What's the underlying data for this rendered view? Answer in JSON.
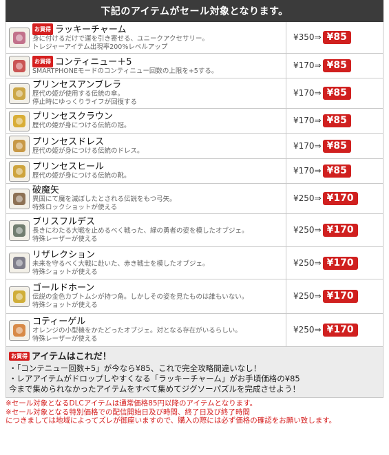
{
  "header": "下記のアイテムがセール対象となります。",
  "deal_badge": "お買得",
  "arrow": "⇒",
  "items": [
    {
      "name": "ラッキーチャーム",
      "desc1": "身に付けるだけで運を引き寄せる、ユニークアクセサリー。",
      "desc2": "トレジャーアイテム出現率200%レベルアップ",
      "old": "¥350",
      "new": "¥85",
      "deal": true,
      "icon": "lucky-charm-icon",
      "color": "#b85a7a"
    },
    {
      "name": "コンティニュー＋5",
      "desc1": "SMARTPHONEモードのコンティニュー回数の上限を+5する。",
      "desc2": "",
      "old": "¥170",
      "new": "¥85",
      "deal": true,
      "icon": "continue-icon",
      "color": "#c23a3a"
    },
    {
      "name": "プリンセスアンブレラ",
      "desc1": "歴代の姫が使用する伝統の傘。",
      "desc2": "停止時にゆっくりライフが回復する",
      "old": "¥170",
      "new": "¥85",
      "deal": false,
      "icon": "umbrella-icon",
      "color": "#c49a2a"
    },
    {
      "name": "プリンセスクラウン",
      "desc1": "歴代の姫が身につける伝統の冠。",
      "desc2": "",
      "old": "¥170",
      "new": "¥85",
      "deal": false,
      "icon": "crown-icon",
      "color": "#d4a218"
    },
    {
      "name": "プリンセスドレス",
      "desc1": "歴代の姫が身につける伝統のドレス。",
      "desc2": "",
      "old": "¥170",
      "new": "¥85",
      "deal": false,
      "icon": "dress-icon",
      "color": "#c08a2a"
    },
    {
      "name": "プリンセスヒール",
      "desc1": "歴代の姫が身につける伝統の靴。",
      "desc2": "",
      "old": "¥170",
      "new": "¥85",
      "deal": false,
      "icon": "heel-icon",
      "color": "#c7961f"
    },
    {
      "name": "破魔矢",
      "desc1": "異国にて魔を滅ぼしたとされる伝説をもつ弓矢。",
      "desc2": "特殊ロックショットが使える",
      "old": "¥250",
      "new": "¥170",
      "deal": false,
      "icon": "bow-icon",
      "color": "#7a5a3a"
    },
    {
      "name": "ブリスフルデス",
      "desc1": "長きにわたる大戦を止めるべく戦った、緑の勇者の姿を模したオブジェ。",
      "desc2": "特殊レーザーが使える",
      "old": "¥250",
      "new": "¥170",
      "deal": false,
      "icon": "cannon-green-icon",
      "color": "#5a6a5a"
    },
    {
      "name": "リザレクション",
      "desc1": "未来を守るべく大戦に赴いた、赤き戦士を模したオブジェ。",
      "desc2": "特殊ショットが使える",
      "old": "¥250",
      "new": "¥170",
      "deal": false,
      "icon": "cannon-red-icon",
      "color": "#6a6a7a"
    },
    {
      "name": "ゴールドホーン",
      "desc1": "伝説の金色カブトムシが持つ角。しかしその姿を見たものは誰もいない。",
      "desc2": "特殊ショットが使える",
      "old": "¥250",
      "new": "¥170",
      "deal": false,
      "icon": "horn-icon",
      "color": "#c9a21a"
    },
    {
      "name": "コティーゲル",
      "desc1": "オレンジの小型機をかたどったオブジェ。対となる存在がいるらしい。",
      "desc2": "特殊レーザーが使える",
      "old": "¥250",
      "new": "¥170",
      "deal": false,
      "icon": "orange-craft-icon",
      "color": "#d2782a"
    }
  ],
  "bottom": {
    "title": "アイテムはこれだ！",
    "lines": [
      "・「コンテニュー回数+5」が今なら¥85、これで完全攻略間違いなし！",
      "・レアアイテムがドロップしやすくなる「ラッキーチャーム」がお手頃価格の¥85",
      "今まで集められなかったアイテムをすべて集めてジグソーパズルを完成させよう！"
    ]
  },
  "notes": [
    "※セール対象となるDLCアイテムは通常価格85円以降のアイテムとなります。",
    "※セール対象となる特別価格での配信開始日及び時間、終了日及び終了時間",
    "につきましては地域によってズレが御座いますので、購入の際には必ず価格の確認をお願い致します。"
  ]
}
